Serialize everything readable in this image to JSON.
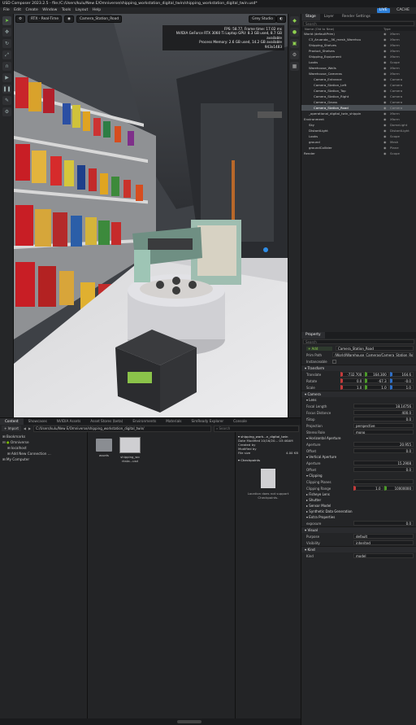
{
  "app": {
    "title": "USD Composer  2023.2.5  -  file:/C:/Users/kulu/New E/Omniverse/shipping_workstation_digital_twin/shipping_workstation_digital_twin.usd*",
    "menus": [
      "File",
      "Edit",
      "Create",
      "Window",
      "Tools",
      "Layout",
      "Help"
    ],
    "live_label": "LIVE",
    "cache_label": "CACHE"
  },
  "viewport": {
    "render_mode": "RTX - Real-Time",
    "camera": "Camera_Station_Road",
    "lighting": "Grey Studio",
    "stats": [
      "FPS: 58.77, Frame time: 17.02 ms",
      "NVIDIA GeForce RTX 3060 Ti Laptop GPU: 8.3 GB used, 8.7 GB available",
      "Process Memory: 2.6 GB used, 14.2 GB available",
      "943x1483"
    ],
    "axis_label": "cm"
  },
  "stage": {
    "tabs": [
      "Stage",
      "Layer",
      "Render Settings"
    ],
    "search_placeholder": "Search",
    "headers": [
      "Name (Old to New)",
      "Type"
    ],
    "rows": [
      {
        "name": "World (defaultPrim)",
        "type": "Xform",
        "indent": 0,
        "sel": false
      },
      {
        "name": "C3_Aruanda__5K_mesh_Warehou",
        "type": "Xform",
        "indent": 1,
        "sel": false
      },
      {
        "name": "Shipping_Shelves",
        "type": "Xform",
        "indent": 1,
        "sel": false
      },
      {
        "name": "Product_Shelves",
        "type": "Xform",
        "indent": 1,
        "sel": false
      },
      {
        "name": "Shipping_Equipment",
        "type": "Xform",
        "indent": 1,
        "sel": false
      },
      {
        "name": "Looks",
        "type": "Scope",
        "indent": 1,
        "sel": false
      },
      {
        "name": "Warehouse_Walls",
        "type": "Xform",
        "indent": 1,
        "sel": false
      },
      {
        "name": "Warehouse_Cameras",
        "type": "Xform",
        "indent": 1,
        "sel": false
      },
      {
        "name": "Camera_Entrance",
        "type": "Camera",
        "indent": 2,
        "sel": false
      },
      {
        "name": "Camera_Station_Left",
        "type": "Camera",
        "indent": 2,
        "sel": false
      },
      {
        "name": "Camera_Station_Top",
        "type": "Camera",
        "indent": 2,
        "sel": false
      },
      {
        "name": "Camera_Station_Right",
        "type": "Camera",
        "indent": 2,
        "sel": false
      },
      {
        "name": "Camera_Gauss",
        "type": "Camera",
        "indent": 2,
        "sel": false
      },
      {
        "name": "Camera_Station_Road",
        "type": "Camera",
        "indent": 2,
        "sel": true
      },
      {
        "name": "_operational_digital_twin_shippin",
        "type": "Xform",
        "indent": 1,
        "sel": false
      },
      {
        "name": "Environment",
        "type": "Xform",
        "indent": 0,
        "sel": false
      },
      {
        "name": "Sky",
        "type": "DomeLight",
        "indent": 1,
        "sel": false
      },
      {
        "name": "DistantLight",
        "type": "DistantLight",
        "indent": 1,
        "sel": false
      },
      {
        "name": "Looks",
        "type": "Scope",
        "indent": 1,
        "sel": false
      },
      {
        "name": "ground",
        "type": "Mesh",
        "indent": 1,
        "sel": false
      },
      {
        "name": "groundCollider",
        "type": "Plane",
        "indent": 1,
        "sel": false
      },
      {
        "name": "Render",
        "type": "Scope",
        "indent": 0,
        "sel": false
      }
    ]
  },
  "property": {
    "tab": "Property",
    "search_placeholder": "Search",
    "add_label": "Add",
    "prim_name": "Camera_Station_Road",
    "prim_path_label": "Prim Path",
    "prim_path": "/World/Warehouse_Cameras/Camera_Station_Road",
    "instanceable_label": "Instanceable",
    "transform": {
      "title": "Transform",
      "translate_label": "Translate",
      "translate": [
        "-732.700",
        "164.300",
        "164.6"
      ],
      "rotate_label": "Rotate",
      "rotate": [
        "0.0",
        "-67.3",
        "-0.0"
      ],
      "scale_label": "Scale",
      "scale": [
        "1.0",
        "1.0",
        "1.0"
      ]
    },
    "camera": {
      "title": "Camera",
      "lens_title": "Lens",
      "focal_length_label": "Focal Length",
      "focal_length": "18.14756",
      "focus_distance_label": "Focus Distance",
      "focus_distance": "400.0",
      "fstop_label": "fStop",
      "fstop": "0.0",
      "projection_label": "Projection",
      "projection": "perspective",
      "stereo_role_label": "Stereo Role",
      "stereo_role": "mono",
      "horizontal_title": "Horizontal Aperture",
      "h_aperture_label": "Aperture",
      "h_aperture": "20.955",
      "h_offset_label": "Offset",
      "h_offset": "0.0",
      "vertical_title": "Vertical Aperture",
      "v_aperture_label": "Aperture",
      "v_aperture": "15.2908",
      "v_offset_label": "Offset",
      "v_offset": "0.0",
      "clipping_title": "Clipping",
      "clipping_planes_label": "Clipping Planes",
      "clipping_range_label": "Clipping Range",
      "clipping_range": [
        "1.0",
        "10000000"
      ],
      "fisheye_title": "Fisheye Lens",
      "shutter_title": "Shutter",
      "sensor_title": "Sensor Model",
      "synthetic_title": "Synthetic Data Generation",
      "extra_title": "Extra Properties",
      "exposure_label": "exposure",
      "exposure": "0.0"
    },
    "visual": {
      "title": "Visual",
      "purpose_label": "Purpose",
      "purpose": "default",
      "visibility_label": "Visibility",
      "visibility": "inherited"
    },
    "kind": {
      "title": "Kind",
      "kind_label": "Kind",
      "kind": "model"
    }
  },
  "content": {
    "tabs": [
      "Content",
      "Showcases",
      "NVIDIA Assets",
      "Asset Stores (beta)",
      "Environments",
      "Materials",
      "SimReady Explorer",
      "Console"
    ],
    "import_label": "Import",
    "path": "C:/Users/kulu/New E/Omniverse/shipping_workstation_digital_twin/",
    "search_placeholder": "Search",
    "tree": [
      "Bookmarks",
      "Omniverse",
      "localhost",
      "Add New Connection ...",
      "My Computer"
    ],
    "files": [
      {
        "name": "assets"
      },
      {
        "name": "shipping_wo rksta...usd"
      }
    ],
    "details": {
      "file": "shipping_work...n_digital_twin",
      "date_label": "Date Modified",
      "date": "10/16/20...  03:46AM",
      "created_label": "Created by",
      "modified_label": "Modified by",
      "size_label": "File size",
      "size": "4.00 KB",
      "checkpoints_title": "Checkpoints",
      "checkpoints_msg": "Location does not support Checkpoints."
    }
  },
  "colors": {
    "accent": "#76b900",
    "selection": "#4a4f54",
    "x_axis": "#c33b3b",
    "y_axis": "#4c9a2a",
    "z_axis": "#2f6fc6"
  }
}
